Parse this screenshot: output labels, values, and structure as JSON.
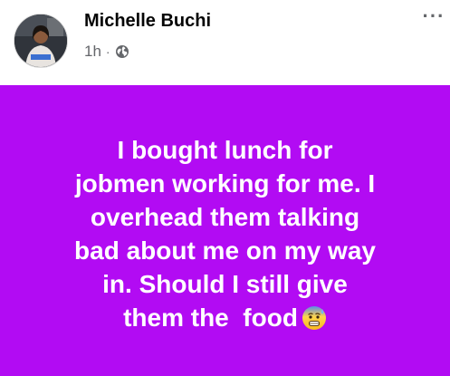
{
  "post": {
    "author": "Michelle Buchi",
    "time": "1h",
    "separator": "·",
    "privacy_icon": "globe-icon",
    "more_icon": "more-options-icon",
    "more_label": "···",
    "text_lines": [
      "I bought lunch for",
      "jobmen working for me. I",
      "overhead them talking",
      "bad about me on my way",
      "in. Should I still give",
      "them the  food"
    ],
    "emoji": "anxious-face-with-sweat-emoji",
    "background_color": "#b20bf3",
    "text_color": "#ffffff"
  }
}
